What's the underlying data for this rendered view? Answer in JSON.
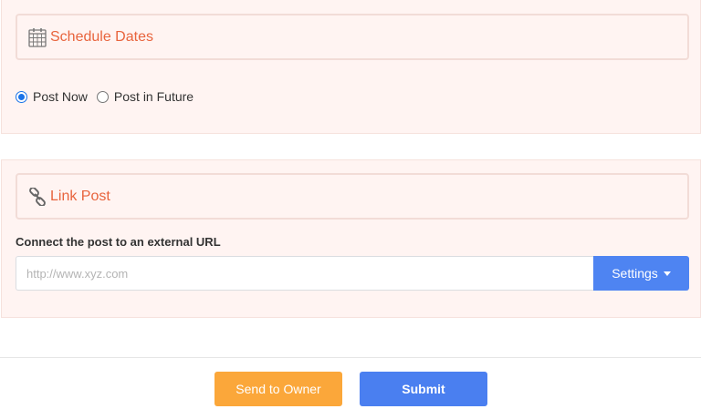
{
  "schedule": {
    "title": "Schedule Dates",
    "icon": "calendar-icon",
    "options": [
      {
        "label": "Post Now",
        "checked": true
      },
      {
        "label": "Post in Future",
        "checked": false
      }
    ]
  },
  "link": {
    "title": "Link Post",
    "icon": "link-icon",
    "url_label": "Connect the post to an external URL",
    "url_placeholder": "http://www.xyz.com",
    "url_value": "",
    "settings_label": "Settings"
  },
  "footer": {
    "send_label": "Send to Owner",
    "submit_label": "Submit"
  },
  "colors": {
    "accent_title": "#e8643d",
    "panel_bg": "#fff4f2",
    "primary": "#4e84f2",
    "warning": "#fba73a"
  }
}
